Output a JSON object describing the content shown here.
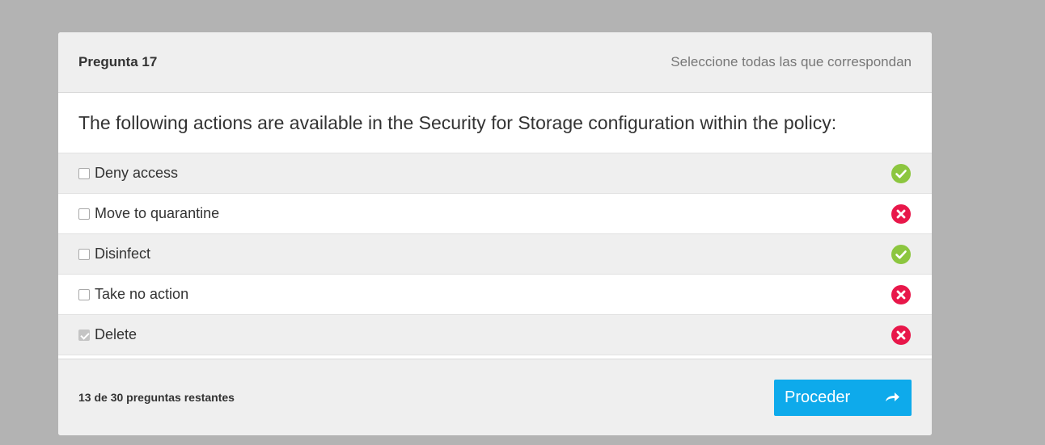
{
  "header": {
    "question_number": "Pregunta 17",
    "instruction": "Seleccione todas las que correspondan"
  },
  "question": {
    "text": "The following actions are available in the Security for Storage configuration within the policy:"
  },
  "options": [
    {
      "label": "Deny access",
      "checked": false,
      "result": "correct"
    },
    {
      "label": "Move to quarantine",
      "checked": false,
      "result": "incorrect"
    },
    {
      "label": "Disinfect",
      "checked": false,
      "result": "correct"
    },
    {
      "label": "Take no action",
      "checked": false,
      "result": "incorrect"
    },
    {
      "label": "Delete",
      "checked": true,
      "result": "incorrect"
    }
  ],
  "footer": {
    "remaining_text": "13 de 30 preguntas restantes",
    "proceed_label": "Proceder",
    "proceed_icon": "share-arrow-icon"
  },
  "colors": {
    "correct": "#8cc63f",
    "incorrect": "#e8174a",
    "button": "#0eaaeb",
    "background": "#b3b3b3"
  }
}
